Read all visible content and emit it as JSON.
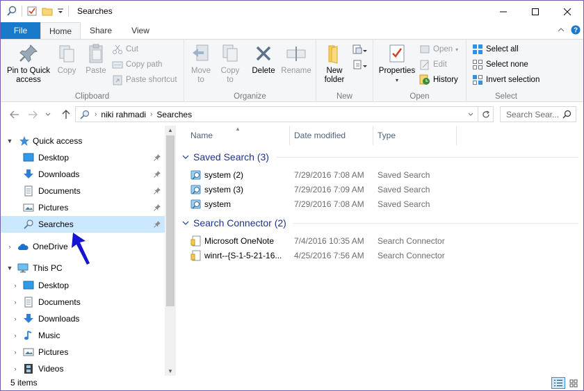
{
  "window": {
    "title": "Searches"
  },
  "ribbon_tabs": {
    "file": "File",
    "home": "Home",
    "share": "Share",
    "view": "View"
  },
  "ribbon": {
    "clipboard": {
      "label": "Clipboard",
      "pin": "Pin to Quick access",
      "copy": "Copy",
      "paste": "Paste",
      "cut": "Cut",
      "copy_path": "Copy path",
      "paste_shortcut": "Paste shortcut"
    },
    "organize": {
      "label": "Organize",
      "move_to": "Move to",
      "copy_to": "Copy to",
      "delete": "Delete",
      "rename": "Rename"
    },
    "new": {
      "label": "New",
      "new_folder": "New folder"
    },
    "open": {
      "label": "Open",
      "properties": "Properties",
      "open": "Open",
      "edit": "Edit",
      "history": "History"
    },
    "select": {
      "label": "Select",
      "select_all": "Select all",
      "select_none": "Select none",
      "invert": "Invert selection"
    }
  },
  "address": {
    "crumbs": [
      "niki rahmadi",
      "Searches"
    ],
    "search_placeholder": "Search Sear..."
  },
  "nav": {
    "quick_access": "Quick access",
    "quick_items": [
      "Desktop",
      "Downloads",
      "Documents",
      "Pictures",
      "Searches"
    ],
    "onedrive": "OneDrive",
    "this_pc": "This PC",
    "pc_items": [
      "Desktop",
      "Documents",
      "Downloads",
      "Music",
      "Pictures",
      "Videos"
    ]
  },
  "columns": {
    "name": "Name",
    "date": "Date modified",
    "type": "Type"
  },
  "groups": [
    {
      "title": "Saved Search (3)",
      "rows": [
        {
          "name": "system (2)",
          "date": "7/29/2016 7:08 AM",
          "type": "Saved Search"
        },
        {
          "name": "system (3)",
          "date": "7/29/2016 7:09 AM",
          "type": "Saved Search"
        },
        {
          "name": "system",
          "date": "7/29/2016 7:08 AM",
          "type": "Saved Search"
        }
      ]
    },
    {
      "title": "Search Connector (2)",
      "rows": [
        {
          "name": "Microsoft OneNote",
          "date": "7/4/2016 10:35 AM",
          "type": "Search Connector"
        },
        {
          "name": "winrt--{S-1-5-21-16...",
          "date": "4/25/2016 7:56 AM",
          "type": "Search Connector"
        }
      ]
    }
  ],
  "status": {
    "count": "5 items"
  },
  "colors": {
    "file_tab": "#1979ca",
    "selection": "#cce8ff",
    "group_header": "#1e3287",
    "annotation_arrow": "#1515d0"
  }
}
